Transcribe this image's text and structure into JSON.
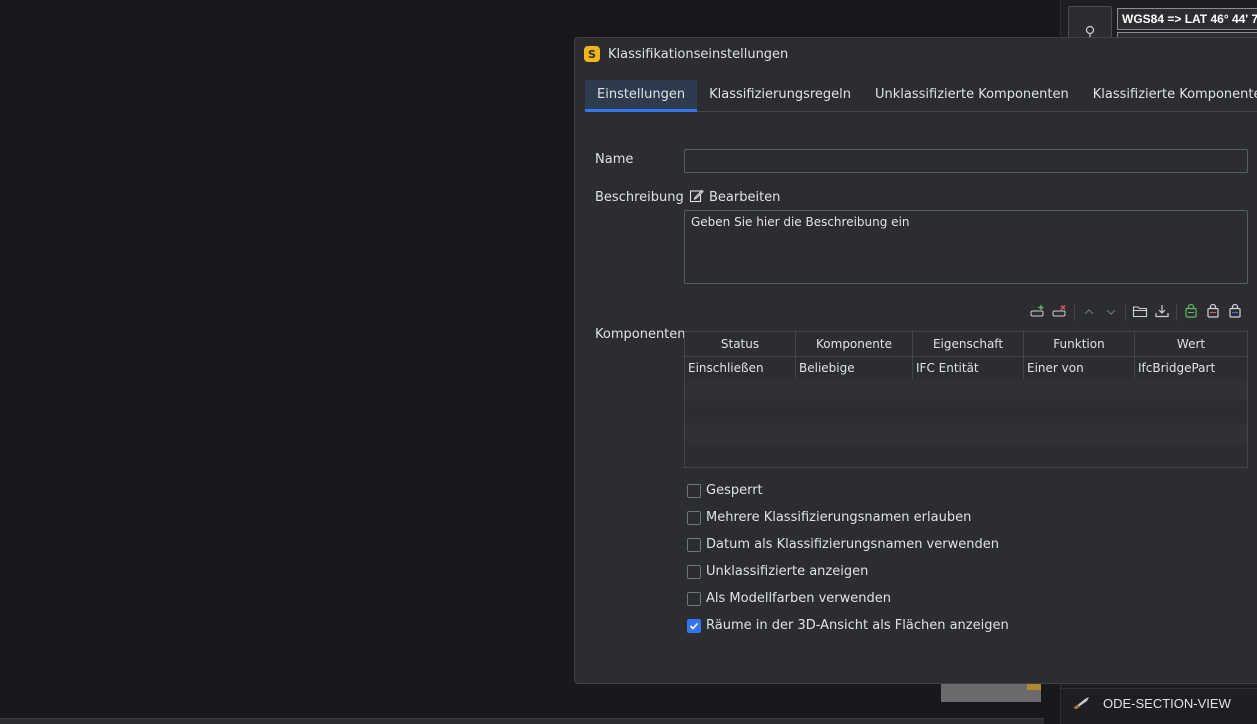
{
  "background": {
    "coordinate_text": "WGS84 => LAT 46° 44' 7",
    "bottom_item_label": "ODE-SECTION-VIEW"
  },
  "dialog": {
    "app_icon_letter": "S",
    "title": "Klassifikationseinstellungen",
    "tabs": [
      {
        "label": "Einstellungen",
        "active": true
      },
      {
        "label": "Klassifizierungsregeln",
        "active": false
      },
      {
        "label": "Unklassifizierte Komponenten",
        "active": false
      },
      {
        "label": "Klassifizierte Komponenten",
        "active": false
      }
    ],
    "name_label": "Name",
    "name_value": "",
    "description_label": "Beschreibung",
    "edit_label": "Bearbeiten",
    "description_placeholder": "Geben Sie hier die Beschreibung ein",
    "components_label": "Komponenten",
    "table": {
      "headers": [
        "Status",
        "Komponente",
        "Eigenschaft",
        "Funktion",
        "Wert"
      ],
      "rows": [
        [
          "Einschließen",
          "Beliebige",
          "IFC Entität",
          "Einer von",
          "IfcBridgePart"
        ]
      ]
    },
    "options": [
      {
        "label": "Gesperrt",
        "checked": false
      },
      {
        "label": "Mehrere Klassifizierungsnamen erlauben",
        "checked": false
      },
      {
        "label": "Datum als Klassifizierungsnamen verwenden",
        "checked": false
      },
      {
        "label": "Unklassifizierte anzeigen",
        "checked": false
      },
      {
        "label": "Als Modellfarben verwenden",
        "checked": false
      },
      {
        "label": "Räume in der 3D-Ansicht als Flächen anzeigen",
        "checked": true
      }
    ],
    "colors": {
      "accent": "#3574f0",
      "app_icon": "#f0b51a",
      "add_icon": "#5fb865",
      "remove_icon": "#e05555"
    }
  }
}
